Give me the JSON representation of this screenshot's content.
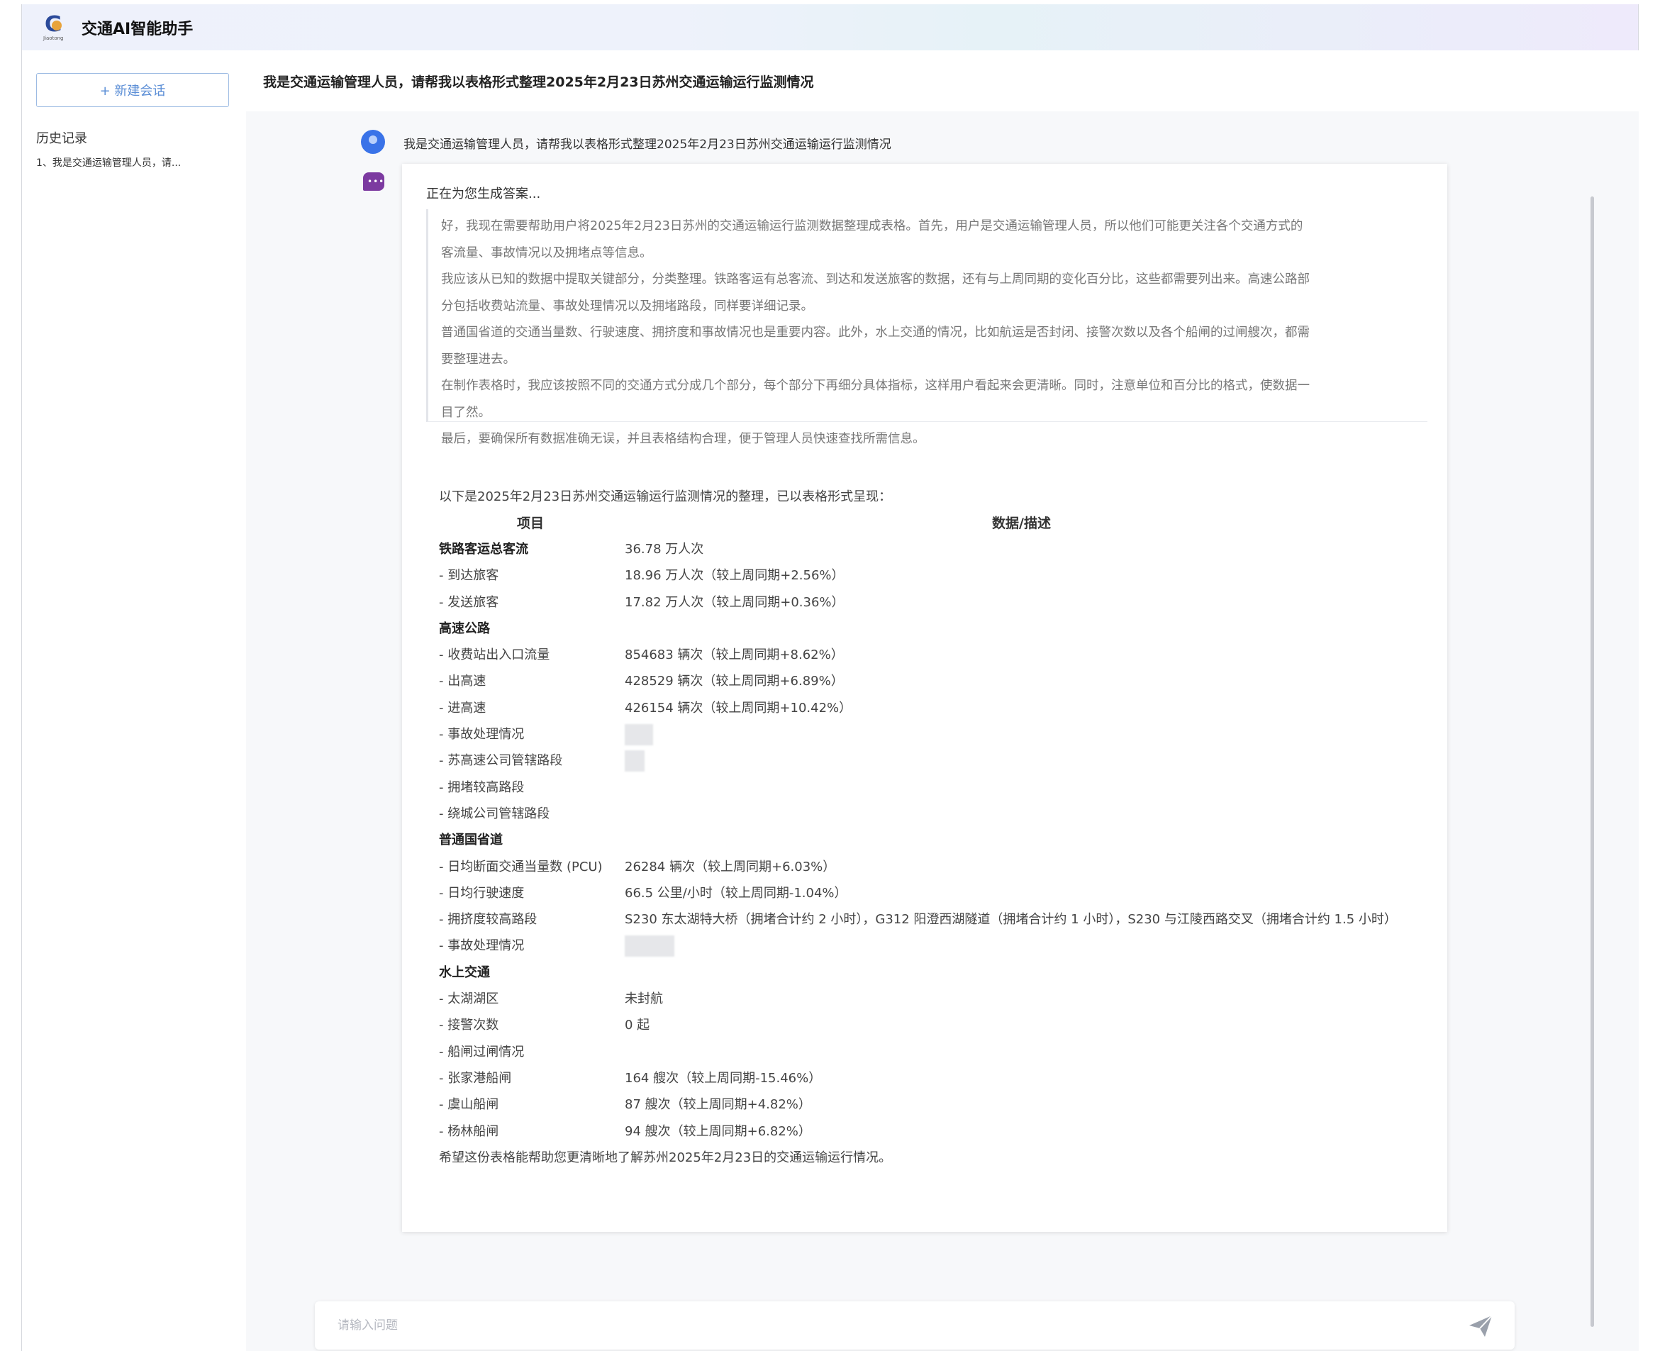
{
  "app": {
    "title": "交通AI智能助手",
    "logo_sub": "Jiaotong"
  },
  "sidebar": {
    "new_chat_label": "+ 新建会话",
    "history_title": "历史记录",
    "history_items": [
      "1、我是交通运输管理人员，请..."
    ]
  },
  "conversation": {
    "header_question": "我是交通运输管理人员，请帮我以表格形式整理2025年2月23日苏州交通运输运行监测情况",
    "user_message": "我是交通运输管理人员，请帮我以表格形式整理2025年2月23日苏州交通运输运行监测情况",
    "bot_status": "正在为您生成答案...",
    "thinking": [
      "好，我现在需要帮助用户将2025年2月23日苏州的交通运输运行监测数据整理成表格。首先，用户是交通运输管理人员，所以他们可能更关注各个交通方式的",
      "客流量、事故情况以及拥堵点等信息。",
      "我应该从已知的数据中提取关键部分，分类整理。铁路客运有总客流、到达和发送旅客的数据，还有与上周同期的变化百分比，这些都需要列出来。高速公路部",
      "分包括收费站流量、事故处理情况以及拥堵路段，同样要详细记录。",
      "普通国省道的交通当量数、行驶速度、拥挤度和事故情况也是重要内容。此外，水上交通的情况，比如航运是否封闭、接警次数以及各个船闸的过闸艘次，都需",
      "要整理进去。",
      "在制作表格时，我应该按照不同的交通方式分成几个部分，每个部分下再细分具体指标，这样用户看起来会更清晰。同时，注意单位和百分比的格式，使数据一",
      "目了然。",
      "最后，要确保所有数据准确无误，并且表格结构合理，便于管理人员快速查找所需信息。"
    ],
    "answer": {
      "intro": "以下是2025年2月23日苏州交通运输运行监测情况的整理，已以表格形式呈现：",
      "col_item": "项目",
      "col_data": "数据/描述",
      "rows": [
        {
          "k": "铁路客运总客流",
          "v": "36.78 万人次",
          "section": true
        },
        {
          "k": "- 到达旅客",
          "v": "18.96 万人次（较上周同期+2.56%）"
        },
        {
          "k": "- 发送旅客",
          "v": "17.82 万人次（较上周同期+0.36%）"
        },
        {
          "k": "高速公路",
          "v": "",
          "section": true
        },
        {
          "k": "- 收费站出入口流量",
          "v": "854683 辆次（较上周同期+8.62%）"
        },
        {
          "k": "- 出高速",
          "v": "428529 辆次（较上周同期+6.89%）"
        },
        {
          "k": "- 进高速",
          "v": "426154 辆次（较上周同期+10.42%）"
        },
        {
          "k": "- 事故处理情况",
          "v": ""
        },
        {
          "k": "- 苏高速公司管辖路段",
          "v": ""
        },
        {
          "k": "- 拥堵较高路段",
          "v": ""
        },
        {
          "k": "- 绕城公司管辖路段",
          "v": ""
        },
        {
          "k": "普通国省道",
          "v": "",
          "section": true
        },
        {
          "k": "- 日均断面交通当量数 (PCU)",
          "v": "26284 辆次（较上周同期+6.03%）"
        },
        {
          "k": "- 日均行驶速度",
          "v": "66.5 公里/小时（较上周同期-1.04%）"
        },
        {
          "k": "- 拥挤度较高路段",
          "v": "S230 东太湖特大桥（拥堵合计约 2 小时），G312 阳澄西湖隧道（拥堵合计约 1 小时），S230 与江陵西路交叉（拥堵合计约 1.5 小时）"
        },
        {
          "k": "- 事故处理情况",
          "v": ""
        },
        {
          "k": "水上交通",
          "v": "",
          "section": true
        },
        {
          "k": "- 太湖湖区",
          "v": "未封航"
        },
        {
          "k": "- 接警次数",
          "v": "0 起"
        },
        {
          "k": "- 船闸过闸情况",
          "v": ""
        },
        {
          "k": "- 张家港船闸",
          "v": "164 艘次（较上周同期-15.46%）"
        },
        {
          "k": "- 虞山船闸",
          "v": "87 艘次（较上周同期+4.82%）"
        },
        {
          "k": "- 杨林船闸",
          "v": "94 艘次（较上周同期+6.82%）"
        }
      ],
      "outro": "希望这份表格能帮助您更清晰地了解苏州2025年2月23日的交通运输运行情况。"
    }
  },
  "input": {
    "placeholder": "请输入问题",
    "value": ""
  },
  "colors": {
    "accent": "#3a73e8",
    "bot_avatar": "#7c3aa0",
    "new_chat_border": "#9dbbe3"
  },
  "icons": {
    "send": "paper-plane-icon",
    "user": "user-avatar-icon",
    "bot": "chat-bubble-icon"
  }
}
